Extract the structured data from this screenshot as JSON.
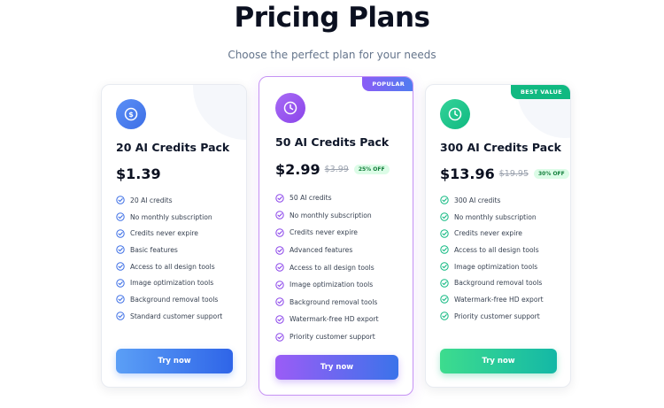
{
  "header": {
    "title": "Pricing Plans",
    "subtitle": "Choose the perfect plan for your needs"
  },
  "plans": [
    {
      "name": "20 AI Credits Pack",
      "price": "$1.39",
      "icon": "dollar-coin-icon",
      "accent": "#3d6fe6",
      "features": [
        "20 AI credits",
        "No monthly subscription",
        "Credits never expire",
        "Basic features",
        "Access to all design tools",
        "Image optimization tools",
        "Background removal tools",
        "Standard customer support"
      ],
      "button_label": "Try now"
    },
    {
      "name": "50 AI Credits Pack",
      "price": "$2.99",
      "old_price": "$3.99",
      "discount": "25% OFF",
      "badge": "POPULAR",
      "icon": "clock-icon",
      "accent": "#8b45ea",
      "features": [
        "50 AI credits",
        "No monthly subscription",
        "Credits never expire",
        "Advanced features",
        "Access to all design tools",
        "Image optimization tools",
        "Background removal tools",
        "Watermark-free HD export",
        "Priority customer support"
      ],
      "button_label": "Try now"
    },
    {
      "name": "300 AI Credits Pack",
      "price": "$13.96",
      "old_price": "$19.95",
      "discount": "30% OFF",
      "badge": "BEST VALUE",
      "icon": "clock-icon",
      "accent": "#10b981",
      "features": [
        "300 AI credits",
        "No monthly subscription",
        "Credits never expire",
        "Access to all design tools",
        "Image optimization tools",
        "Background removal tools",
        "Watermark-free HD export",
        "Priority customer support"
      ],
      "button_label": "Try now"
    }
  ]
}
